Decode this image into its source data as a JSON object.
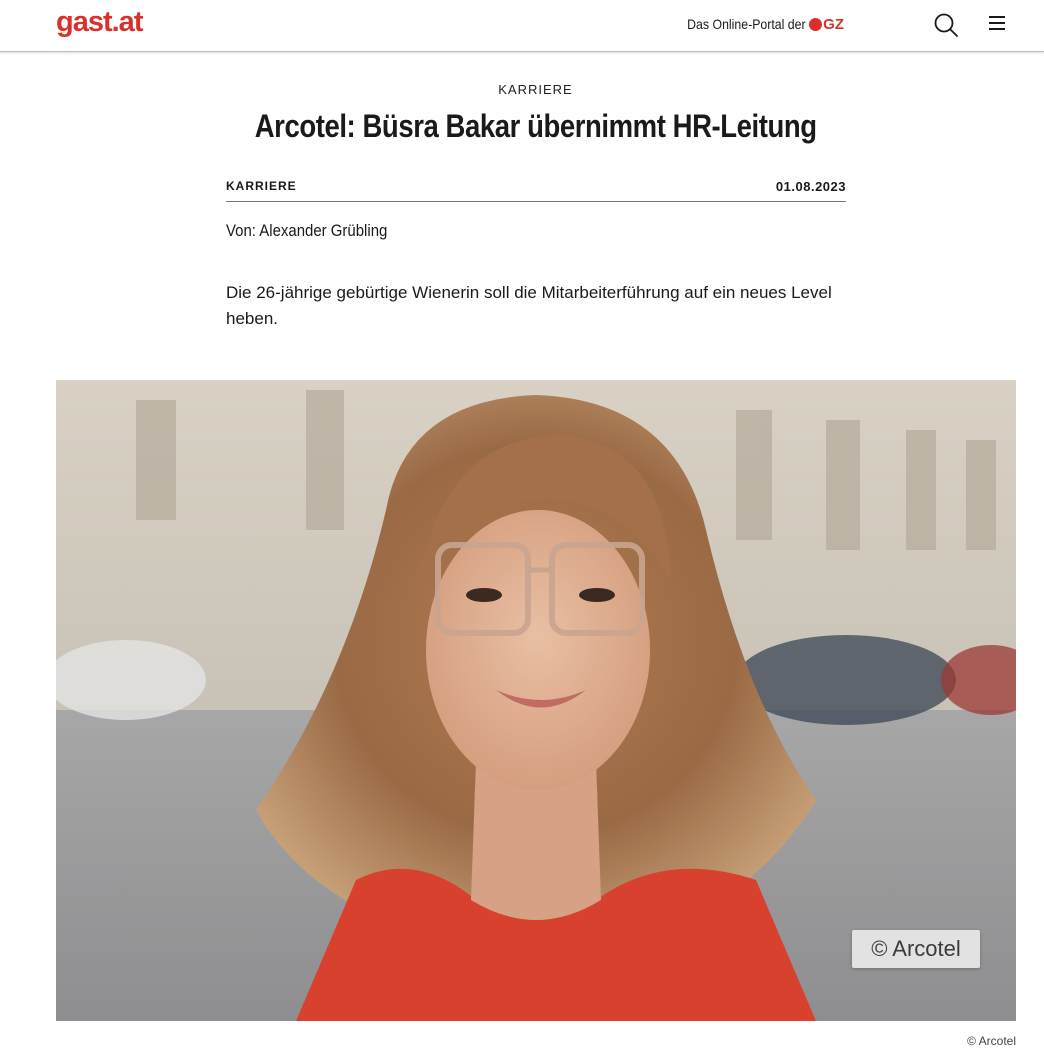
{
  "header": {
    "logo_text": "gast.at",
    "portal_text": "Das Online-Portal der",
    "portal_brand": "GZ",
    "brand_color": "#d9302b",
    "icons": [
      "search-icon",
      "hamburger-menu-icon"
    ]
  },
  "article": {
    "kicker": "KARRIERE",
    "headline": "Arcotel: Büsra Bakar übernimmt HR-Leitung",
    "category": "KARRIERE",
    "date": "01.08.2023",
    "author": "Von: Alexander Grübling",
    "lead": "Die 26-jährige gebürtige Wienerin soll die Mitarbeiterführung auf ein neues Level heben.",
    "image": {
      "badge": "© Arcotel",
      "credit": "© Arcotel"
    }
  }
}
